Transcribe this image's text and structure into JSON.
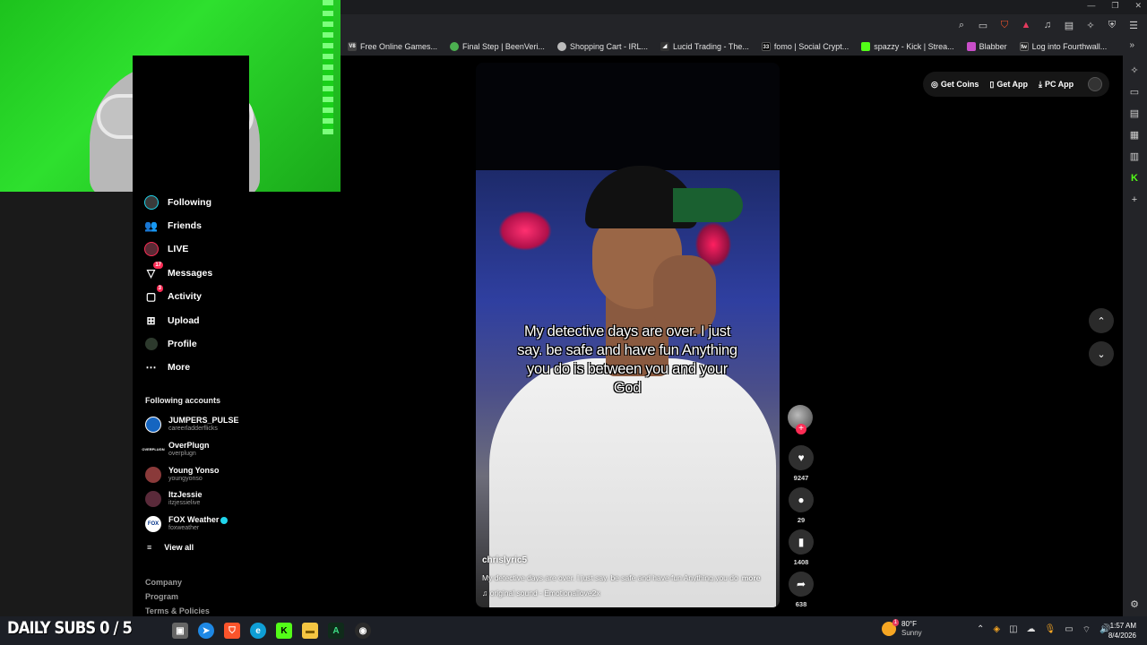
{
  "bookmarks": [
    {
      "label": "Free Online Games...",
      "color": "#ffffff"
    },
    {
      "label": "Final Step | BeenVeri...",
      "color": "#4caf50"
    },
    {
      "label": "Shopping Cart - IRL...",
      "color": "#bbbbbb"
    },
    {
      "label": "Lucid Trading - The...",
      "color": "#dddddd"
    },
    {
      "label": "fomo | Social Crypt...",
      "color": "#111111"
    },
    {
      "label": "spazzy - Kick | Strea...",
      "color": "#53fc18"
    },
    {
      "label": "Blabber",
      "color": "#c94ec9"
    },
    {
      "label": "Log into Fourthwall...",
      "color": "#222222"
    }
  ],
  "bookmarks_more": "»",
  "nav": {
    "following": "Following",
    "friends": "Friends",
    "live": "LIVE",
    "messages": "Messages",
    "messages_badge": "17",
    "activity": "Activity",
    "activity_badge": "3",
    "upload": "Upload",
    "profile": "Profile",
    "more": "More"
  },
  "following_accounts": {
    "title": "Following accounts",
    "items": [
      {
        "name": "JUMPERS_PULSE",
        "handle": "careerladderflicks",
        "verified": false
      },
      {
        "name": "OverPlugn",
        "handle": "overplugn",
        "verified": false
      },
      {
        "name": "Young Yonso",
        "handle": "youngyonso",
        "verified": false
      },
      {
        "name": "ItzJessie",
        "handle": "itzjessielive",
        "verified": false
      },
      {
        "name": "FOX Weather",
        "handle": "foxweather",
        "verified": true
      }
    ],
    "view_all": "View all",
    "logo_texts": {
      "overplugn": "OVERPLUGN",
      "fox": "FOX"
    }
  },
  "footer": {
    "company": "Company",
    "program": "Program",
    "terms": "Terms & Policies"
  },
  "topbar": {
    "get_coins": "Get Coins",
    "get_app": "Get App",
    "pc_app": "PC App"
  },
  "video": {
    "caption": "My detective days are over. I just say. be safe and have fun Anything you do is between you and your God",
    "author": "chrislyric5",
    "description": "My detective days are over. I just say. be safe and have fun Anything you do",
    "more": "more",
    "sound": "original sound - Emotionallove2x",
    "likes": "9247",
    "comments": "29",
    "saves": "1408",
    "shares": "638"
  },
  "taskbar": {
    "overlay_text": "DAILY SUBS 0 / 5",
    "temp": "80°F",
    "condition": "Sunny",
    "weather_badge": "1",
    "time": "1:57 AM",
    "date": "8/4/2026"
  },
  "colors": {
    "accent": "#fe2c55",
    "browser_bg": "#232428",
    "taskbar": "#1c1f26"
  }
}
